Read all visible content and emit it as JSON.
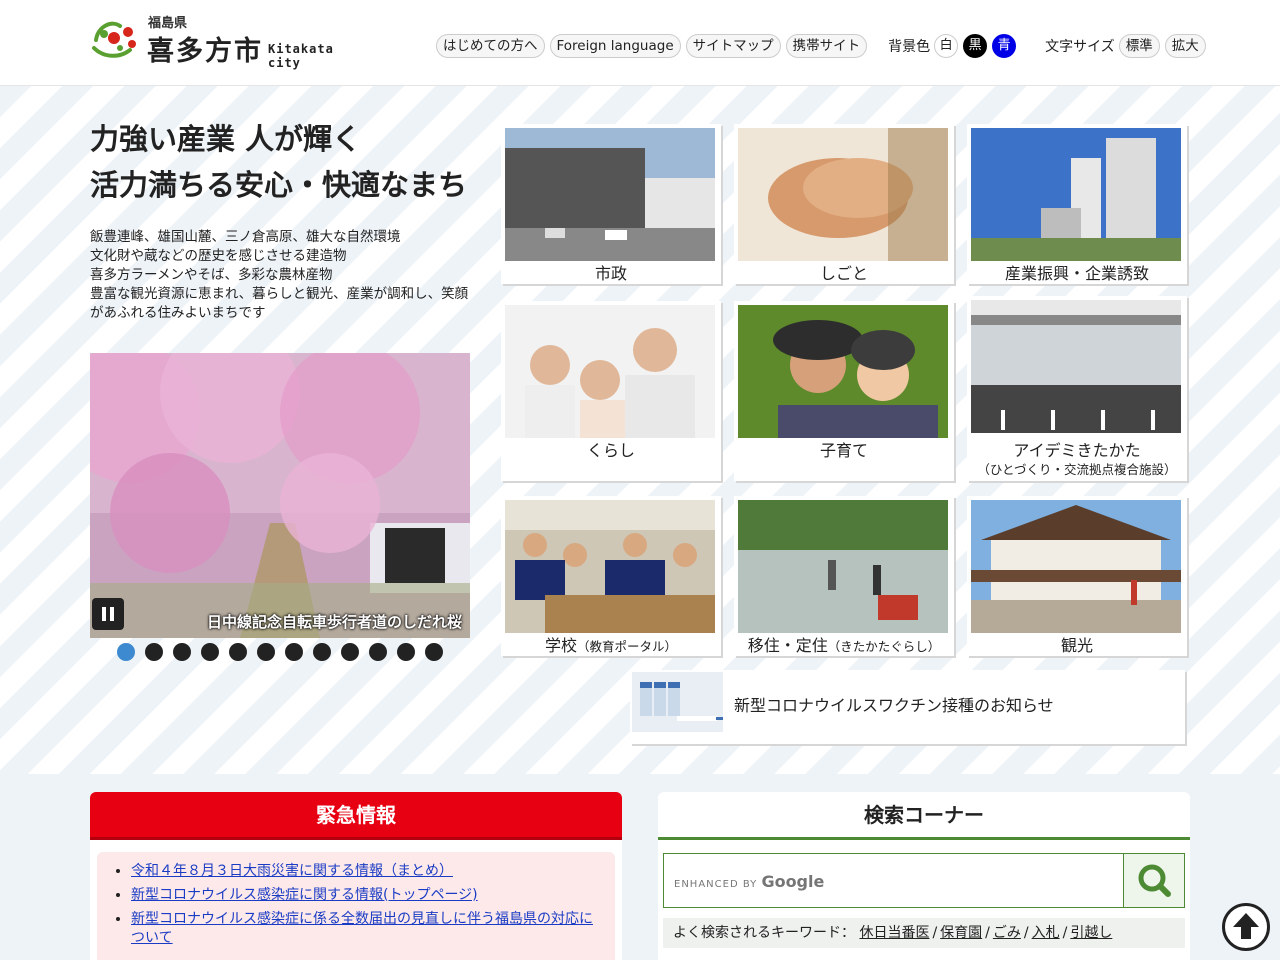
{
  "header": {
    "pref": "福島県",
    "city": "喜多方市",
    "city_en": "Kitakata city",
    "nav": [
      {
        "label": "はじめての方へ"
      },
      {
        "label": "Foreign language"
      },
      {
        "label": "サイトマップ"
      },
      {
        "label": "携帯サイト"
      }
    ],
    "bg_label": "背景色",
    "bg_options": [
      "白",
      "黒",
      "青"
    ],
    "font_label": "文字サイズ",
    "font_options": [
      "標準",
      "拡大"
    ]
  },
  "hero": {
    "catch_line1": "力強い産業 人が輝く",
    "catch_line2": "活力満ちる安心・快適なまち",
    "desc_lines": [
      "飯豊連峰、雄国山麓、三ノ倉高原、雄大な自然環境",
      "文化財や蔵などの歴史を感じさせる建造物",
      "喜多方ラーメンやそば、多彩な農林産物",
      "豊富な観光資源に恵まれ、暮らしと観光、産業が調和し、笑顔があふれる住みよいまちです"
    ],
    "slide_caption": "日中線記念自転車歩行者道のしだれ桜",
    "slide_count": 12,
    "slide_active": 1
  },
  "tiles": [
    {
      "label": "市政",
      "sub": ""
    },
    {
      "label": "しごと",
      "sub": ""
    },
    {
      "label": "産業振興・企業誘致",
      "sub": ""
    },
    {
      "label": "くらし",
      "sub": ""
    },
    {
      "label": "子育て",
      "sub": ""
    },
    {
      "label": "アイデミきたかた",
      "sub": "（ひとづくり・交流拠点複合施設）"
    },
    {
      "label": "学校",
      "sub": "（教育ポータル）"
    },
    {
      "label": "移住・定住",
      "sub": "（きたかたぐらし）"
    },
    {
      "label": "観光",
      "sub": ""
    }
  ],
  "covid_banner": "新型コロナウイルスワクチン接種のお知らせ",
  "emergency": {
    "title": "緊急情報",
    "items": [
      "令和４年８月３日大雨災害に関する情報（まとめ）",
      "新型コロナウイルス感染症に関する情報(トップページ)",
      "新型コロナウイルス感染症に係る全数届出の見直しに伴う福島県の対応について"
    ]
  },
  "search": {
    "title": "検索コーナー",
    "placeholder_prefix": "ENHANCED BY",
    "placeholder_brand": "Google",
    "keywords_label": "よく検索されるキーワード：",
    "keywords": [
      "休日当番医",
      "保育園",
      "ごみ",
      "入札",
      "引越し"
    ]
  },
  "colors": {
    "emergency_red": "#e60012",
    "search_green": "#4c8a34",
    "dot_active": "#3d8ad1",
    "bg_blue": "#0000e6"
  },
  "icons": [
    "logo-mark-icon",
    "pause-icon",
    "search-icon",
    "arrow-up-icon"
  ]
}
